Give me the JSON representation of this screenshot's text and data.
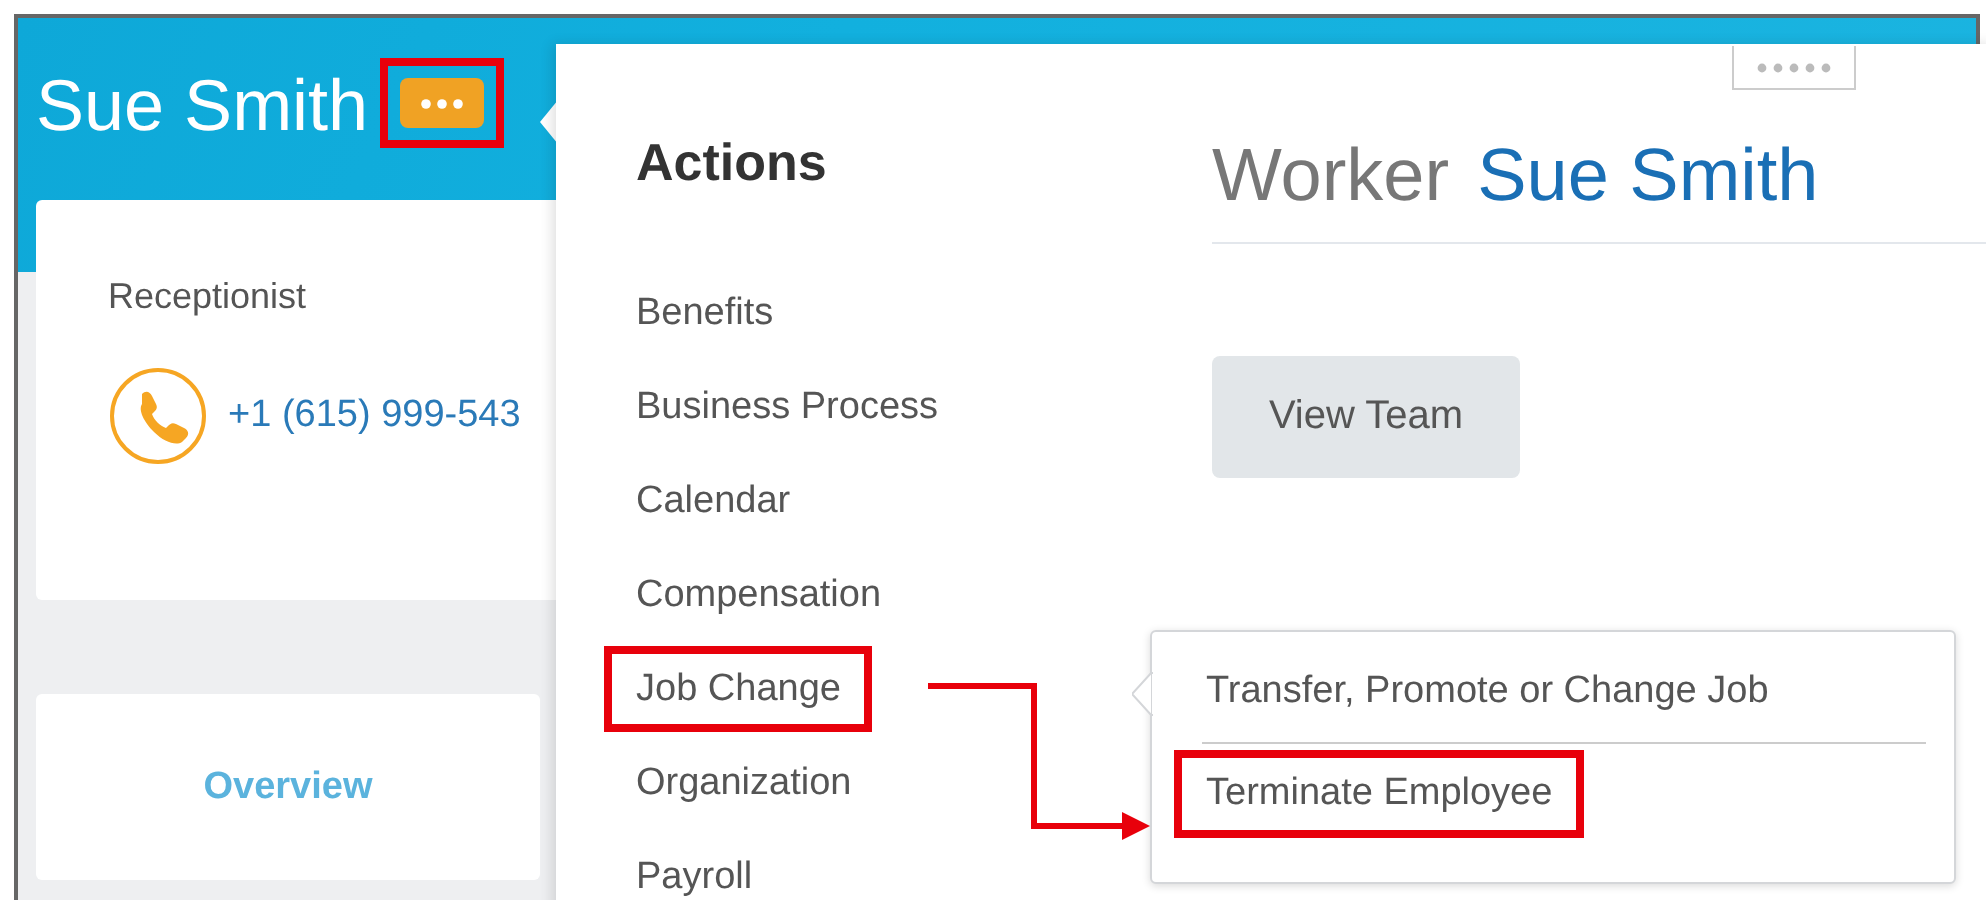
{
  "profile": {
    "name": "Sue Smith",
    "more_button": {
      "highlighted": true
    },
    "job_title": "Receptionist",
    "phone": "+1 (615) 999-543",
    "tabs": [
      {
        "label": "Overview",
        "selected": true
      }
    ]
  },
  "actions_menu": {
    "heading": "Actions",
    "items": [
      {
        "label": "Benefits",
        "highlighted": false
      },
      {
        "label": "Business Process",
        "highlighted": false
      },
      {
        "label": "Calendar",
        "highlighted": false
      },
      {
        "label": "Compensation",
        "highlighted": false
      },
      {
        "label": "Job Change",
        "highlighted": true
      },
      {
        "label": "Organization",
        "highlighted": false
      },
      {
        "label": "Payroll",
        "highlighted": false
      }
    ]
  },
  "worker": {
    "label": "Worker",
    "name": "Sue Smith",
    "buttons": [
      "View Team"
    ]
  },
  "submenu": {
    "items": [
      {
        "label": "Transfer, Promote or Change Job",
        "highlighted": false
      },
      {
        "label": "Terminate Employee",
        "highlighted": true
      }
    ]
  }
}
